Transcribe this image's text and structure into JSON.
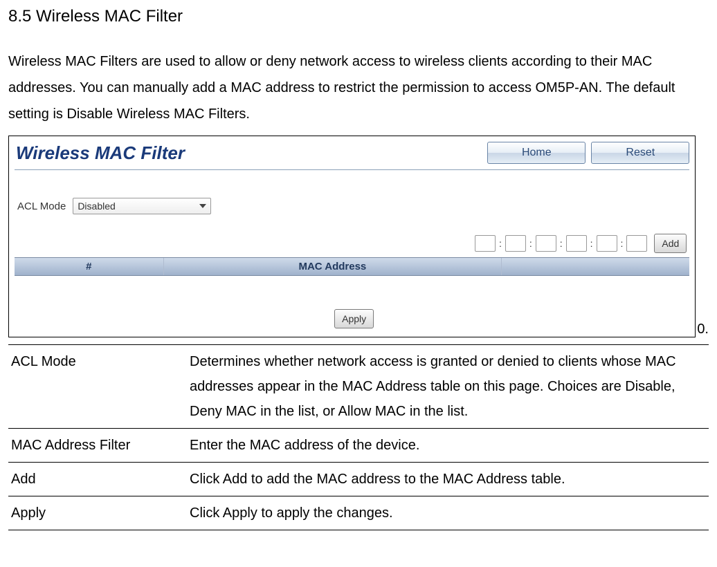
{
  "heading": "8.5 Wireless MAC Filter",
  "intro": "Wireless MAC Filters are used to allow or deny network access to wireless clients according to their MAC addresses. You can manually add a MAC address to restrict the permission to access OM5P-AN. The default setting is Disable Wireless MAC Filters.",
  "screenshot": {
    "title": "Wireless MAC Filter",
    "home_btn": "Home",
    "reset_btn": "Reset",
    "acl_label": "ACL Mode",
    "acl_value": "Disabled",
    "add_btn": "Add",
    "table": {
      "col_num": "#",
      "col_addr": "MAC Address"
    },
    "apply_btn": "Apply"
  },
  "trail": "0.",
  "rows": [
    {
      "label": "ACL Mode",
      "text": "Determines whether network access is granted or denied to clients whose MAC addresses appear in the MAC Address table on this page. Choices are Disable, Deny MAC in the list, or Allow MAC in the list."
    },
    {
      "label": "MAC Address Filter",
      "text": "Enter the MAC address of the device."
    },
    {
      "label": "Add",
      "text": "Click Add to add the MAC address to the MAC Address table."
    },
    {
      "label": "Apply",
      "text": "Click Apply to apply the changes."
    }
  ]
}
